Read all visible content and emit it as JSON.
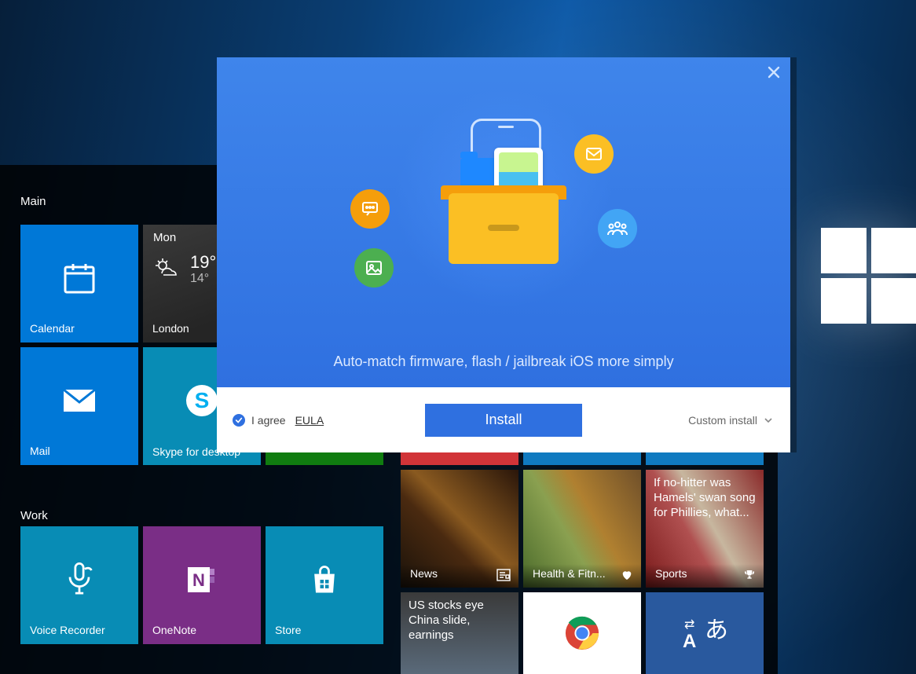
{
  "start_menu": {
    "section_main": "Main",
    "section_work": "Work",
    "tiles": {
      "calendar": "Calendar",
      "weather_day": "Mon",
      "weather_hi": "19°",
      "weather_lo": "14°",
      "weather_city": "London",
      "mail": "Mail",
      "skype": "Skype for desktop",
      "voice_recorder": "Voice Recorder",
      "onenote": "OneNote",
      "store": "Store",
      "news_label": "News",
      "health_label": "Health & Fitn...",
      "sports_label": "Sports",
      "sports_headline": "If no-hitter was Hamels' swan song for Phillies, what...",
      "money_headline": "US stocks eye China slide, earnings"
    }
  },
  "installer": {
    "description": "Auto-match firmware, flash / jailbreak iOS more simply",
    "agree_text": "I agree",
    "eula_text": "EULA",
    "install_btn": "Install",
    "custom_text": "Custom install"
  }
}
